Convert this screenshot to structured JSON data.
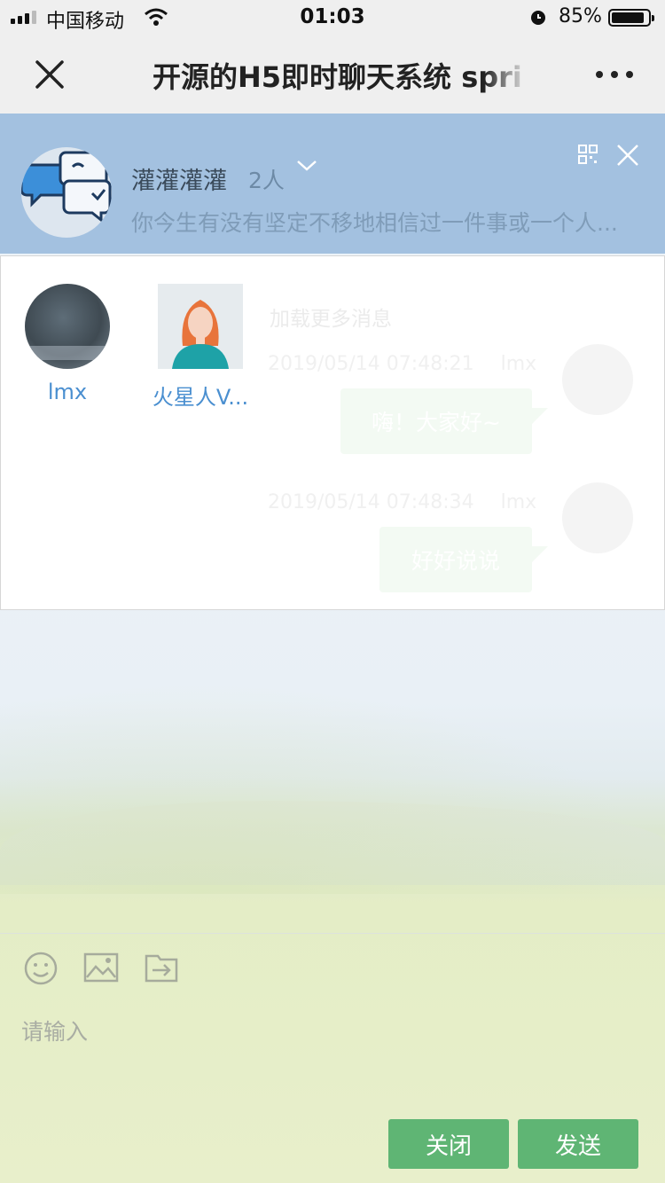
{
  "status_bar": {
    "carrier": "中国移动",
    "time": "01:03",
    "battery": "85%",
    "battery_level": 0.85
  },
  "nav": {
    "title": "开源的H5即时聊天系统 spri"
  },
  "group": {
    "name": "灌灌灌灌",
    "count": "2人",
    "description": "你今生有没有坚定不移地相信过一件事或一个人..."
  },
  "members": [
    {
      "name": "lmx"
    },
    {
      "name": "火星人V..."
    }
  ],
  "chat": {
    "load_more": "加载更多消息",
    "messages": [
      {
        "time": "2019/05/14 07:48:21",
        "user": "lmx",
        "text": "嗨！大家好~"
      },
      {
        "time": "2019/05/14 07:48:34",
        "user": "lmx",
        "text": "好好说说"
      }
    ]
  },
  "composer": {
    "placeholder": "请输入",
    "close_label": "关闭",
    "send_label": "发送"
  },
  "icons": [
    "close-icon",
    "more-icon",
    "chevron-down-icon",
    "qr-code-icon",
    "emoji-icon",
    "image-icon",
    "file-send-icon"
  ],
  "colors": {
    "header_blue": "#a3c1e0",
    "button_green": "#5fb574",
    "link_blue": "#4a8fd0"
  }
}
